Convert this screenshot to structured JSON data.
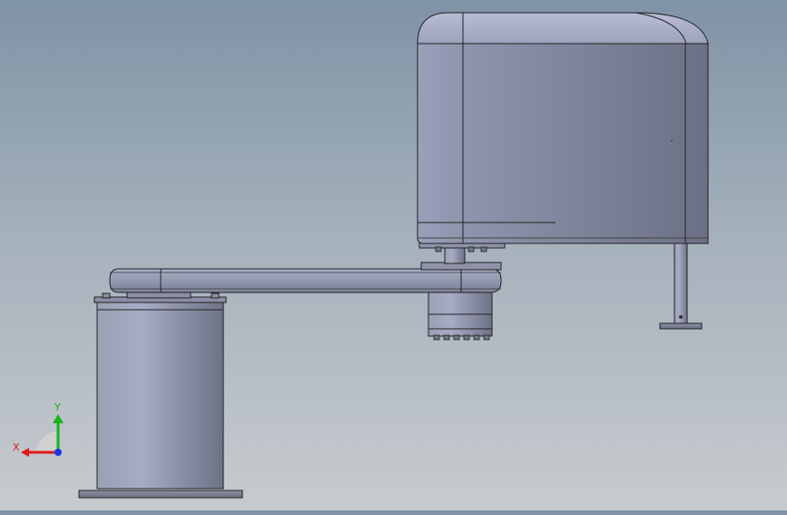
{
  "viewport": {
    "background_top": "#7f93a6",
    "background_bottom": "#c7cbce"
  },
  "model": {
    "name": "",
    "body_color": "#7b8094",
    "edge_color": "#1a1a1a"
  },
  "triad": {
    "x_label": "X",
    "y_label": "Y",
    "x_color": "#e11a1a",
    "y_color": "#17b317",
    "z_color": "#1a3ae0"
  }
}
